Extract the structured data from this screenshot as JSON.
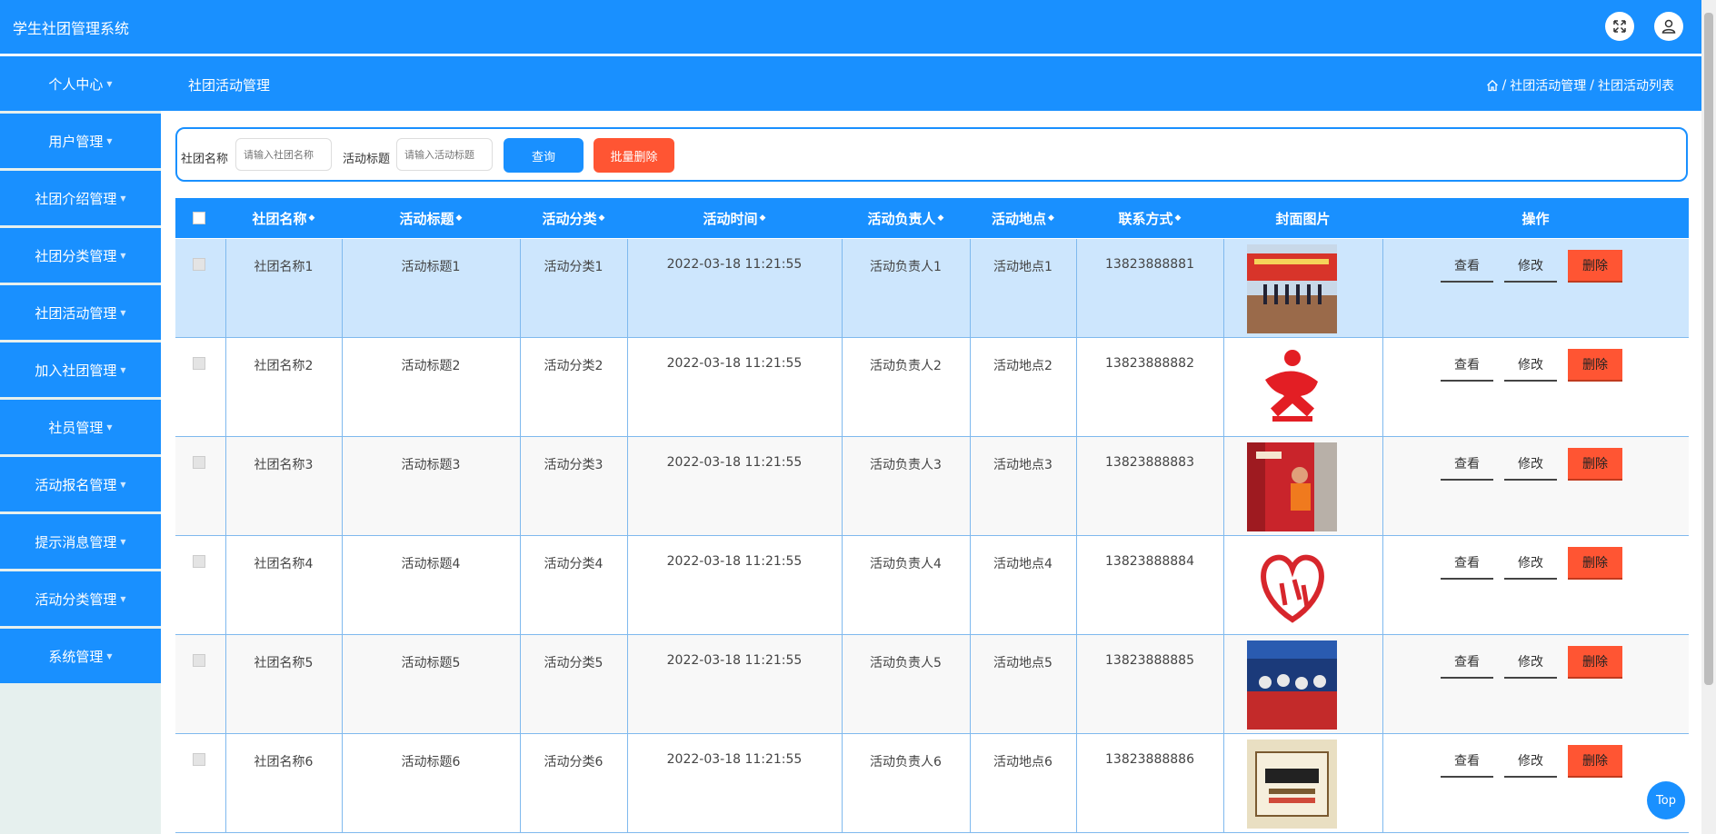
{
  "app": {
    "title": "学生社团管理系统"
  },
  "topbar": {
    "fullscreen_icon": "fullscreen-icon",
    "user_icon": "user-icon"
  },
  "sidebar": {
    "items": [
      {
        "label": "个人中心"
      },
      {
        "label": "用户管理"
      },
      {
        "label": "社团介绍管理"
      },
      {
        "label": "社团分类管理"
      },
      {
        "label": "社团活动管理"
      },
      {
        "label": "加入社团管理"
      },
      {
        "label": "社员管理"
      },
      {
        "label": "活动报名管理"
      },
      {
        "label": "提示消息管理"
      },
      {
        "label": "活动分类管理"
      },
      {
        "label": "系统管理"
      }
    ]
  },
  "page": {
    "title": "社团活动管理",
    "breadcrumb": [
      "社团活动管理",
      "社团活动列表"
    ]
  },
  "search": {
    "club_label": "社团名称",
    "club_placeholder": "请输入社团名称",
    "title_label": "活动标题",
    "title_placeholder": "请输入活动标题",
    "query_label": "查询",
    "batch_delete_label": "批量删除"
  },
  "table": {
    "headers": [
      "社团名称",
      "活动标题",
      "活动分类",
      "活动时间",
      "活动负责人",
      "活动地点",
      "联系方式",
      "封面图片",
      "操作"
    ],
    "rows": [
      {
        "club": "社团名称1",
        "title": "活动标题1",
        "category": "活动分类1",
        "time": "2022-03-18 11:21:55",
        "leader": "活动负责人1",
        "place": "活动地点1",
        "phone": "13823888881",
        "cover": "ceremony-photo"
      },
      {
        "club": "社团名称2",
        "title": "活动标题2",
        "category": "活动分类2",
        "time": "2022-03-18 11:21:55",
        "leader": "活动负责人2",
        "place": "活动地点2",
        "phone": "13823888882",
        "cover": "yiwu-logo"
      },
      {
        "club": "社团名称3",
        "title": "活动标题3",
        "category": "活动分类3",
        "time": "2022-03-18 11:21:55",
        "leader": "活动负责人3",
        "place": "活动地点3",
        "phone": "13823888883",
        "cover": "red-banner-photo"
      },
      {
        "club": "社团名称4",
        "title": "活动标题4",
        "category": "活动分类4",
        "time": "2022-03-18 11:21:55",
        "leader": "活动负责人4",
        "place": "活动地点4",
        "phone": "13823888884",
        "cover": "heart-logo"
      },
      {
        "club": "社团名称5",
        "title": "活动标题5",
        "category": "活动分类5",
        "time": "2022-03-18 11:21:55",
        "leader": "活动负责人5",
        "place": "活动地点5",
        "phone": "13823888885",
        "cover": "group-photo"
      },
      {
        "club": "社团名称6",
        "title": "活动标题6",
        "category": "活动分类6",
        "time": "2022-03-18 11:21:55",
        "leader": "活动负责人6",
        "place": "活动地点6",
        "phone": "13823888886",
        "cover": "poster-photo"
      }
    ],
    "actions": {
      "view": "查看",
      "edit": "修改",
      "delete": "删除"
    }
  },
  "top_button": "Top",
  "colors": {
    "primary": "#1990ff",
    "danger": "#ff5533",
    "highlight_row": "#cde6fd"
  }
}
